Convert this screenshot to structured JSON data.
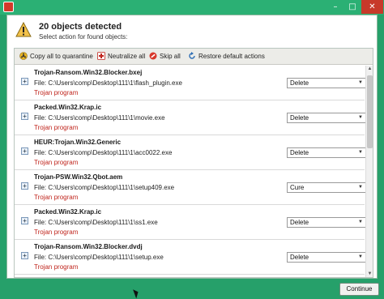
{
  "window": {
    "app_icon": "kaspersky-logo",
    "controls": {
      "minimize": "–",
      "maximize": "□",
      "close": "✕"
    }
  },
  "header": {
    "icon": "warning-icon",
    "title": "20 objects detected",
    "subtitle": "Select action for found objects:"
  },
  "toolbar": {
    "quarantine_label": "Copy all to quarantine",
    "neutralize_label": "Neutralize all",
    "skip_label": "Skip all",
    "restore_label": "Restore default actions"
  },
  "objects": [
    {
      "name": "Trojan-Ransom.Win32.Blocker.bxej",
      "path": "File: C:\\Users\\comp\\Desktop\\111\\1\\flash_plugin.exe",
      "type": "Trojan program",
      "action": "Delete"
    },
    {
      "name": "Packed.Win32.Krap.ic",
      "path": "File: C:\\Users\\comp\\Desktop\\111\\1\\movie.exe",
      "type": "Trojan program",
      "action": "Delete"
    },
    {
      "name": "HEUR:Trojan.Win32.Generic",
      "path": "File: C:\\Users\\comp\\Desktop\\111\\1\\acc0022.exe",
      "type": "Trojan program",
      "action": "Delete"
    },
    {
      "name": "Trojan-PSW.Win32.Qbot.aem",
      "path": "File: C:\\Users\\comp\\Desktop\\111\\1\\setup409.exe",
      "type": "Trojan program",
      "action": "Cure"
    },
    {
      "name": "Packed.Win32.Krap.ic",
      "path": "File: C:\\Users\\comp\\Desktop\\111\\1\\ss1.exe",
      "type": "Trojan program",
      "action": "Delete"
    },
    {
      "name": "Trojan-Ransom.Win32.Blocker.dvdj",
      "path": "File: C:\\Users\\comp\\Desktop\\111\\1\\setup.exe",
      "type": "Trojan program",
      "action": "Delete"
    }
  ],
  "footer": {
    "continue_label": "Continue"
  },
  "colors": {
    "frame": "#26a06a",
    "threat_text": "#c0261e",
    "close_button": "#c7392a"
  }
}
